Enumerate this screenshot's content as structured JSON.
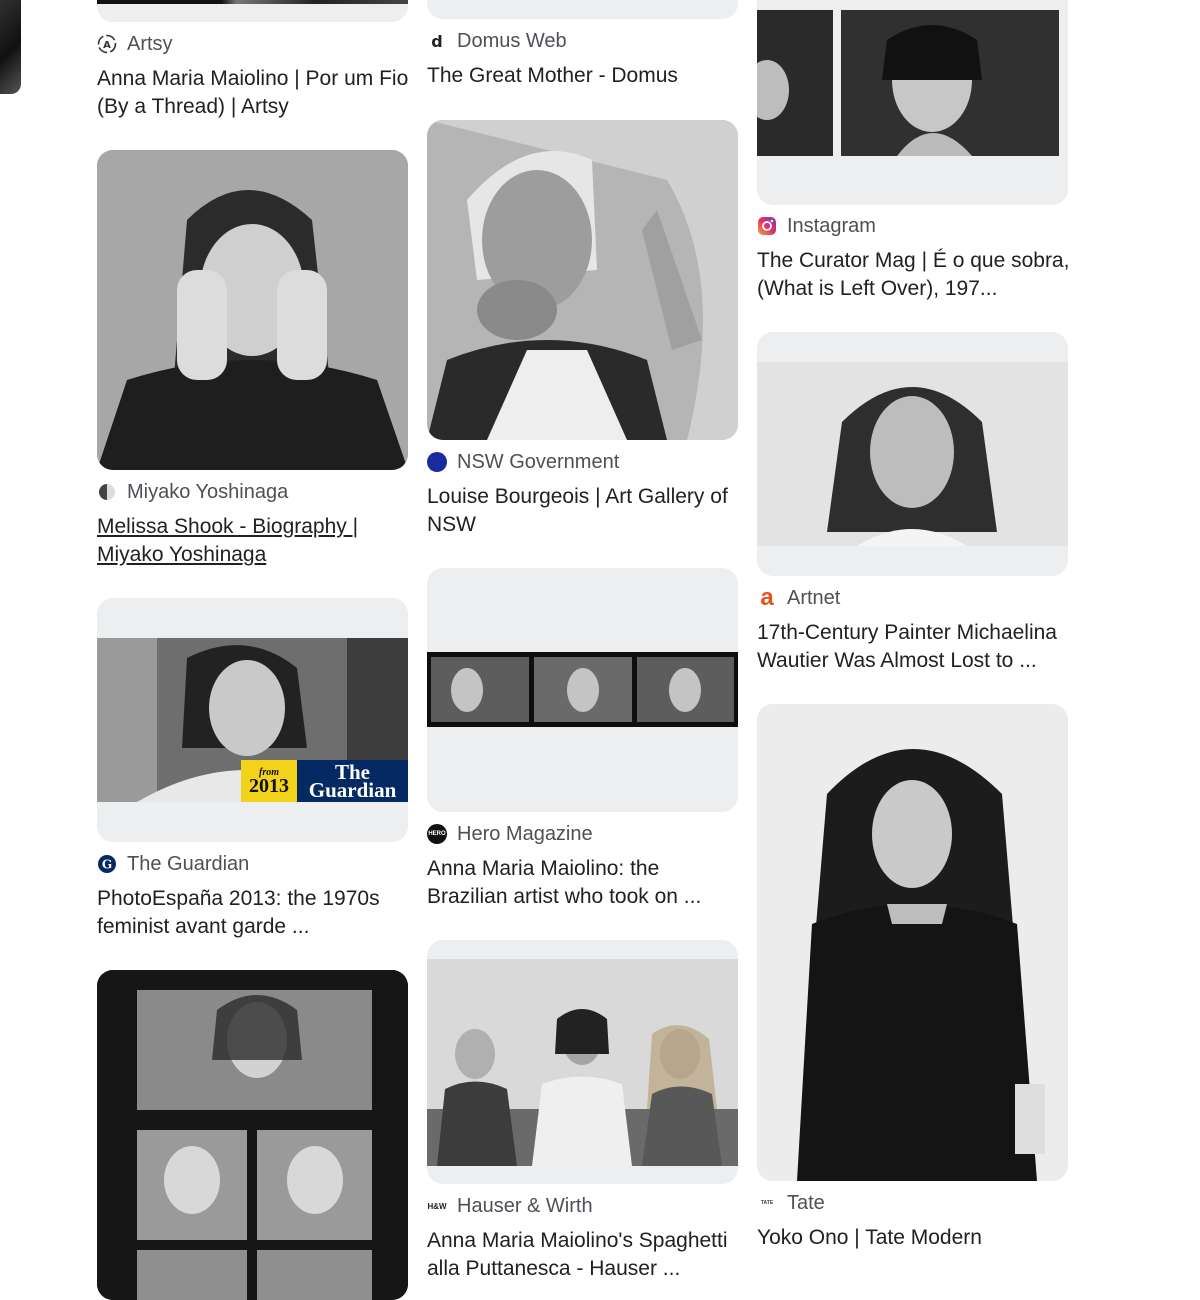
{
  "columns": [
    [
      {
        "source": "Artsy",
        "title": "Anna Maria Maiolino | Por um Fio (By a Thread) | Artsy",
        "icon": "artsy-icon"
      },
      {
        "source": "Miyako Yoshinaga",
        "title": "Melissa Shook - Biography | Miyako Yoshinaga",
        "icon": "half-circle-icon"
      },
      {
        "source": "The Guardian",
        "title": "PhotoEspaña 2013: the 1970s feminist avant garde ...",
        "icon": "guardian-icon",
        "overlay_year_prefix": "from",
        "overlay_year": "2013",
        "overlay_brand": "The Guardian"
      },
      {
        "source": "",
        "title": ""
      }
    ],
    [
      {
        "source": "Domus Web",
        "title": "The Great Mother - Domus",
        "icon": "domus-icon"
      },
      {
        "source": "NSW Government",
        "title": "Louise Bourgeois | Art Gallery of NSW",
        "icon": "blue-dot-icon"
      },
      {
        "source": "Hero Magazine",
        "title": "Anna Maria Maiolino: the Brazilian artist who took on ...",
        "icon": "hero-icon",
        "icon_text": "HERO"
      },
      {
        "source": "Hauser & Wirth",
        "title": "Anna Maria Maiolino's Spaghetti alla Puttanesca - Hauser ...",
        "icon": "hauser-wirth-icon",
        "icon_text": "H&W"
      }
    ],
    [
      {
        "source": "Instagram",
        "title": "The Curator Mag | É o que sobra, (What is Left Over), 197...",
        "icon": "instagram-icon"
      },
      {
        "source": "Artnet",
        "title": "17th-Century Painter Michaelina Wautier Was Almost Lost to ...",
        "icon": "artnet-icon",
        "icon_text": "a"
      },
      {
        "source": "Tate",
        "title": "Yoko Ono | Tate Modern",
        "icon": "tate-icon",
        "icon_text": "TATE"
      }
    ]
  ],
  "colors": {
    "thumb_bg": "#eceef0",
    "nsw_blue": "#1a2ba0",
    "artnet_orange": "#e8521c",
    "guardian_navy": "#052962",
    "guardian_yellow": "#f2d31a"
  }
}
